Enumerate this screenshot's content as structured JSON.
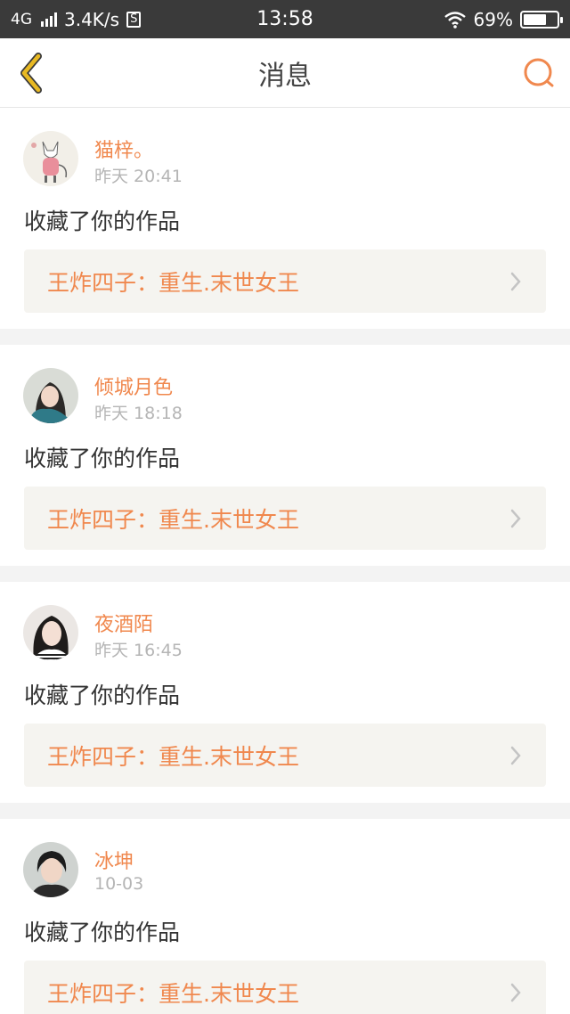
{
  "status_bar": {
    "network": "4G",
    "speed": "3.4K/s",
    "s_badge": "S",
    "time": "13:58",
    "battery": "69%",
    "battery_level": 0.69
  },
  "nav": {
    "title": "消息",
    "back_icon": "chevron-left-icon",
    "search_icon": "search-icon",
    "accent": "#f0884e",
    "back_color": "#e8b923"
  },
  "messages": [
    {
      "user": "猫梓。",
      "time": "昨天 20:41",
      "action": "收藏了你的作品",
      "work": "王炸四子：重生.末世女王"
    },
    {
      "user": "倾城月色",
      "time": "昨天 18:18",
      "action": "收藏了你的作品",
      "work": "王炸四子：重生.末世女王"
    },
    {
      "user": "夜酒陌",
      "time": "昨天 16:45",
      "action": "收藏了你的作品",
      "work": "王炸四子：重生.末世女王"
    },
    {
      "user": "冰坤",
      "time": "10-03",
      "action": "收藏了你的作品",
      "work": "王炸四子：重生.末世女王"
    }
  ]
}
